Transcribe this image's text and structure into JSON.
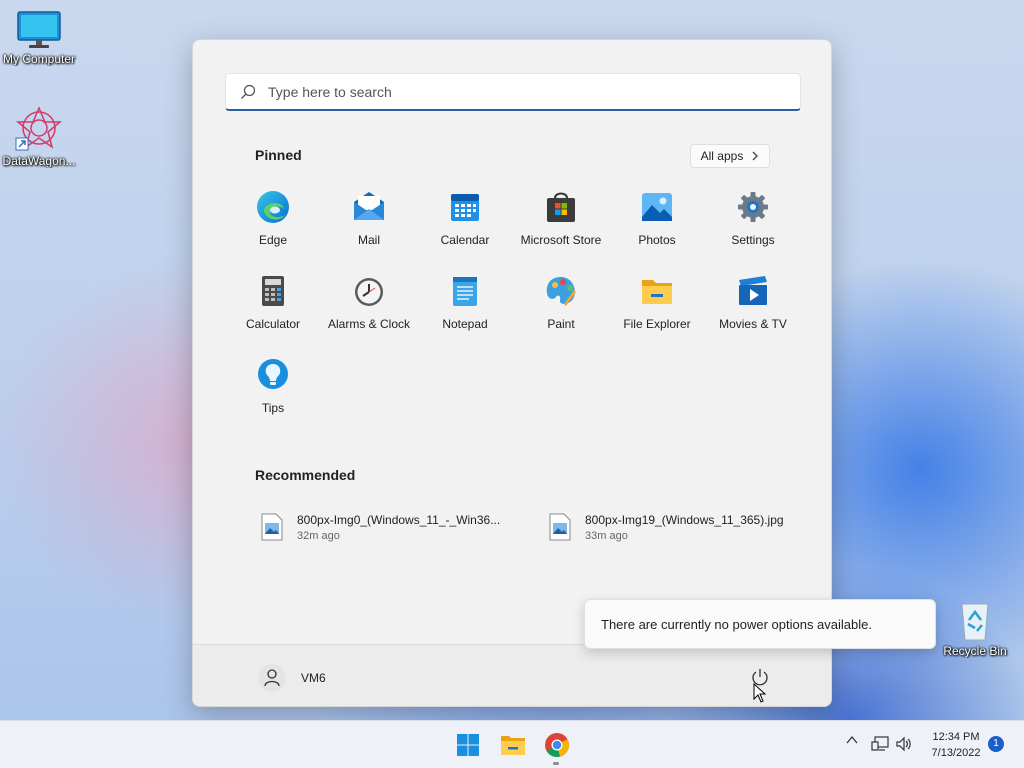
{
  "desktop": {
    "icons": [
      {
        "label": "My Computer",
        "icon": "monitor-icon"
      },
      {
        "label": "DataWagon...",
        "icon": "datawagon-icon"
      },
      {
        "label": "Recycle Bin",
        "icon": "recycle-bin-icon"
      }
    ]
  },
  "start_menu": {
    "search": {
      "placeholder": "Type here to search",
      "icon": "search-icon"
    },
    "pinned_title": "Pinned",
    "all_apps_label": "All apps",
    "pinned": [
      {
        "label": "Edge",
        "icon": "edge-icon"
      },
      {
        "label": "Mail",
        "icon": "mail-icon"
      },
      {
        "label": "Calendar",
        "icon": "calendar-icon"
      },
      {
        "label": "Microsoft Store",
        "icon": "store-icon"
      },
      {
        "label": "Photos",
        "icon": "photos-icon"
      },
      {
        "label": "Settings",
        "icon": "gear-icon"
      },
      {
        "label": "Calculator",
        "icon": "calculator-icon"
      },
      {
        "label": "Alarms & Clock",
        "icon": "clock-icon"
      },
      {
        "label": "Notepad",
        "icon": "notepad-icon"
      },
      {
        "label": "Paint",
        "icon": "paint-icon"
      },
      {
        "label": "File Explorer",
        "icon": "folder-icon"
      },
      {
        "label": "Movies & TV",
        "icon": "movies-icon"
      },
      {
        "label": "Tips",
        "icon": "tips-icon"
      }
    ],
    "recommended_title": "Recommended",
    "recommended": [
      {
        "name": "800px-Img0_(Windows_11_-_Win36...",
        "time": "32m ago"
      },
      {
        "name": "800px-Img19_(Windows_11_365).jpg",
        "time": "33m ago"
      }
    ],
    "user": {
      "name": "VM6"
    },
    "power_tooltip": "There are currently no power options available."
  },
  "taskbar": {
    "apps": [
      "start-icon",
      "file-explorer-icon",
      "chrome-icon"
    ],
    "clock": {
      "time": "12:34 PM",
      "date": "7/13/2022"
    },
    "notification_count": "1"
  },
  "colors": {
    "accent": "#2a5fa6",
    "notification": "#1a5fc8"
  }
}
